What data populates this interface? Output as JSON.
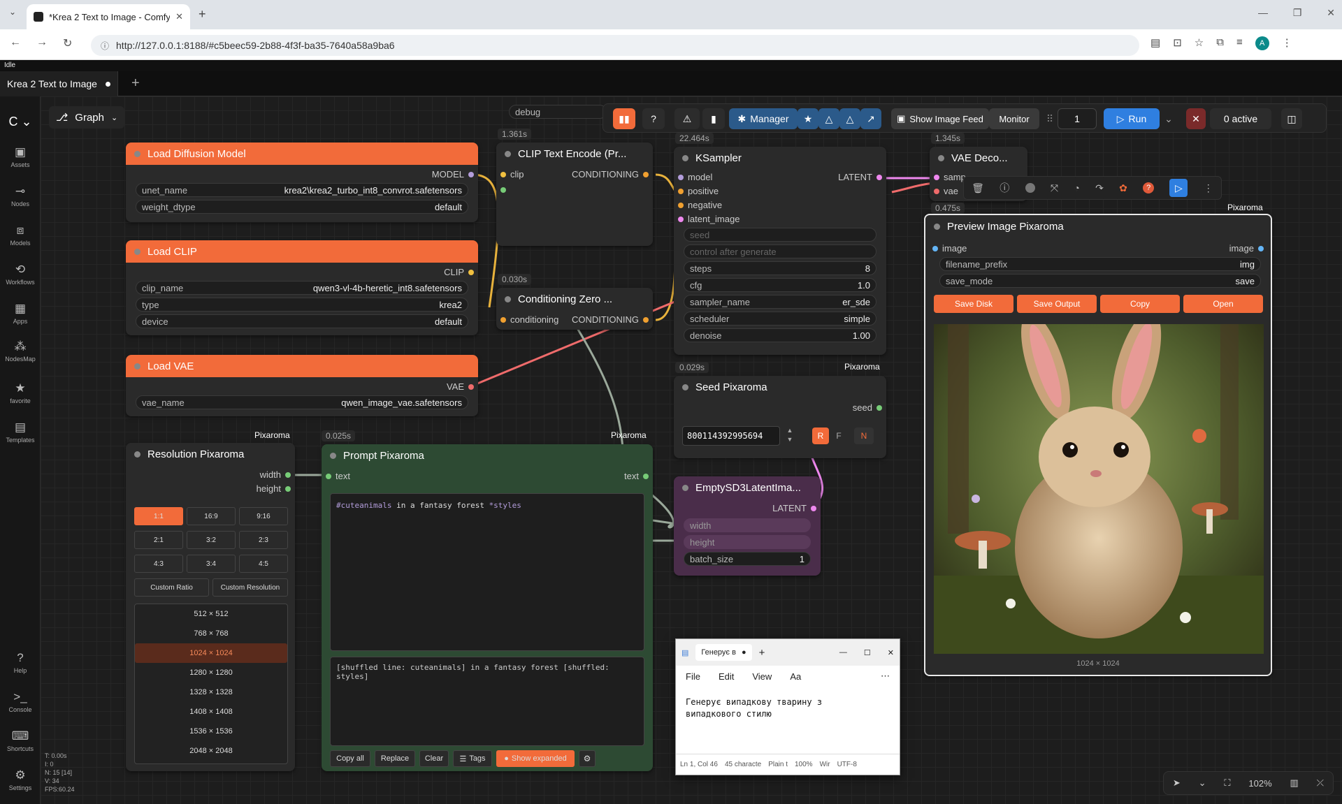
{
  "browser": {
    "tab_title": "*Krea 2 Text to Image - ComfyU",
    "url": "http://127.0.0.1:8188/#c5beec59-2b88-4f3f-ba35-7640a58a9ba6"
  },
  "status": {
    "text": "Idle"
  },
  "workflow_tab": {
    "label": "Krea 2 Text to Image"
  },
  "graph_label": "Graph",
  "sidebar": [
    "Assets",
    "Nodes",
    "Models",
    "Workflows",
    "Apps",
    "NodesMap",
    "favorite",
    "Templates",
    "Help",
    "Console",
    "Shortcuts",
    "Settings"
  ],
  "stats": [
    "T: 0.00s",
    "I: 0",
    "N: 15 [14]",
    "V: 34",
    "FPS:60.24"
  ],
  "toolbar": {
    "manager": "Manager",
    "show_feed": "Show Image Feed",
    "monitor": "Monitor",
    "queue_count": "1",
    "run": "Run",
    "active": "0 active"
  },
  "top_partial": {
    "debug": "debug"
  },
  "load_diffusion": {
    "title": "Load Diffusion Model",
    "output": "MODEL",
    "unet_name_label": "unet_name",
    "unet_name": "krea2\\krea2_turbo_int8_convrot.safetensors",
    "weight_dtype_label": "weight_dtype",
    "weight_dtype": "default"
  },
  "load_clip": {
    "title": "Load CLIP",
    "output": "CLIP",
    "clip_name_label": "clip_name",
    "clip_name": "qwen3-vl-4b-heretic_int8.safetensors",
    "type_label": "type",
    "type": "krea2",
    "device_label": "device",
    "device": "default"
  },
  "load_vae": {
    "title": "Load VAE",
    "output": "VAE",
    "vae_name_label": "vae_name",
    "vae_name": "qwen_image_vae.safetensors"
  },
  "clip_encode": {
    "time": "1.361s",
    "title": "CLIP Text Encode (Pr...",
    "input": "clip",
    "output": "CONDITIONING"
  },
  "cond_zero": {
    "time": "0.030s",
    "title": "Conditioning Zero ...",
    "input": "conditioning",
    "output": "CONDITIONING"
  },
  "ksampler": {
    "time": "22.464s",
    "title": "KSampler",
    "inputs": [
      "model",
      "positive",
      "negative",
      "latent_image"
    ],
    "output": "LATENT",
    "seed": "seed",
    "control": "control after generate",
    "steps_label": "steps",
    "steps": "8",
    "cfg_label": "cfg",
    "cfg": "1.0",
    "sampler_label": "sampler_name",
    "sampler": "er_sde",
    "scheduler_label": "scheduler",
    "scheduler": "simple",
    "denoise_label": "denoise",
    "denoise": "1.00"
  },
  "vae_decode": {
    "time": "1.345s",
    "title": "VAE Deco...",
    "inputs": [
      "samp",
      "vae"
    ]
  },
  "preview": {
    "time": "0.475s",
    "tag": "Pixaroma",
    "title": "Preview Image Pixaroma",
    "input": "image",
    "output": "image",
    "filename_prefix_label": "filename_prefix",
    "filename_prefix": "img",
    "save_mode_label": "save_mode",
    "save_mode": "save",
    "buttons": [
      "Save Disk",
      "Save Output",
      "Copy",
      "Open"
    ],
    "image_caption": "1024 × 1024"
  },
  "seed_node": {
    "time": "0.029s",
    "tag": "Pixaroma",
    "title": "Seed Pixaroma",
    "output": "seed",
    "value": "800114392995694",
    "r": "R",
    "f": "F",
    "n": "N"
  },
  "resolution": {
    "tag": "Pixaroma",
    "title": "Resolution Pixaroma",
    "outputs": [
      "width",
      "height"
    ],
    "ratios": [
      "1:1",
      "16:9",
      "9:16",
      "2:1",
      "3:2",
      "2:3",
      "4:3",
      "3:4",
      "4:5"
    ],
    "custom_ratio": "Custom Ratio",
    "custom_resolution": "Custom Resolution",
    "sizes": [
      "512 × 512",
      "768 × 768",
      "1024 × 1024",
      "1280 × 1280",
      "1328 × 1328",
      "1408 × 1408",
      "1536 × 1536",
      "2048 × 2048"
    ]
  },
  "prompt": {
    "time": "0.025s",
    "tag": "Pixaroma",
    "title": "Prompt Pixaroma",
    "input": "text",
    "output": "text",
    "tag_word": "#cuteanimals",
    "middle": " in a fantasy forest ",
    "style_word": "*styles",
    "expanded": "[shuffled line: cuteanimals] in a fantasy forest [shuffled: styles]",
    "buttons": [
      "Copy all",
      "Replace",
      "Clear",
      "Tags",
      "Show expanded"
    ]
  },
  "empty_latent": {
    "title": "EmptySD3LatentIma...",
    "output": "LATENT",
    "width": "width",
    "height": "height",
    "batch_label": "batch_size",
    "batch": "1"
  },
  "notepad": {
    "tab": "Генерує в",
    "menu": [
      "File",
      "Edit",
      "View"
    ],
    "text1": "Генерує випадкову тварину з",
    "text2": "випадкового стилю",
    "status": [
      "Ln 1, Col 46",
      "45 characte",
      "Plain t",
      "100%",
      "Wir",
      "UTF-8"
    ]
  },
  "bottom_bar": {
    "zoom": "102%"
  },
  "colors": {
    "node_header": "#f26b3a",
    "accent_blue": "#2f7fe0",
    "prompt_bg": "#2d4a33",
    "latent_bg": "#4a2d4a"
  }
}
